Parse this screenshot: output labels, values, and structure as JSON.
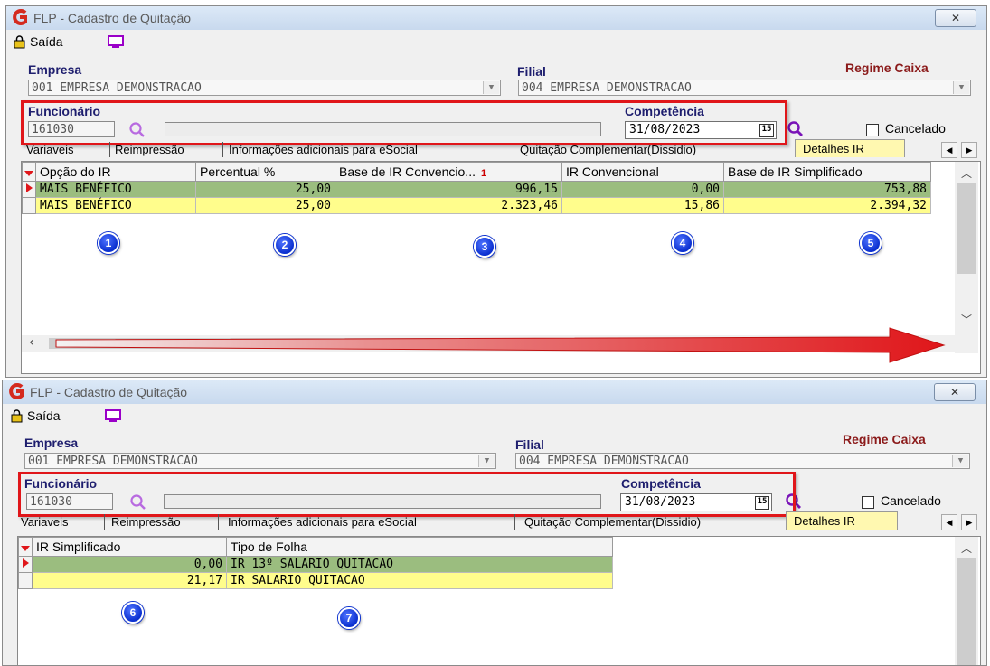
{
  "window": {
    "title": "FLP - Cadastro de Quitação",
    "close_label": "✕",
    "saida_label": "Saída"
  },
  "form": {
    "empresa_label": "Empresa",
    "empresa_value": "001 EMPRESA DEMONSTRACAO",
    "filial_label": "Filial",
    "filial_value": "004 EMPRESA DEMONSTRACAO",
    "regime_label": "Regime Caixa",
    "funcionario_label": "Funcionário",
    "funcionario_value": "161030",
    "competencia_label": "Competência",
    "competencia_value": "31/08/2023",
    "calendar_label": "15",
    "cancelado_label": "Cancelado"
  },
  "tabs": {
    "t1": "Variaveis",
    "t2": "Reimpressão",
    "t3": "Informações adicionais para eSocial",
    "t4": "Quitação Complementar(Dissidio)",
    "active": "Detalhes IR"
  },
  "grid1": {
    "headers": [
      "Opção do IR",
      "Percentual %",
      "Base de IR Convencio...",
      "IR Convencional",
      "Base de IR Simplificado"
    ],
    "sort_marker": "1",
    "rows": [
      [
        "MAIS BENÉFICO",
        "25,00",
        "996,15",
        "0,00",
        "753,88"
      ],
      [
        "MAIS BENÉFICO",
        "25,00",
        "2.323,46",
        "15,86",
        "2.394,32"
      ]
    ]
  },
  "grid2": {
    "headers": [
      "IR Simplificado",
      "Tipo de Folha"
    ],
    "rows": [
      [
        "0,00",
        "IR 13º SALARIO QUITACAO"
      ],
      [
        "21,17",
        "IR SALARIO QUITACAO"
      ]
    ]
  },
  "badges": [
    "1",
    "2",
    "3",
    "4",
    "5",
    "6",
    "7"
  ],
  "colors": {
    "highlight_red": "#e0161a",
    "row_green": "#9bbd7f",
    "row_yellow": "#fffd8c",
    "badge_blue": "#0a2fcf"
  }
}
